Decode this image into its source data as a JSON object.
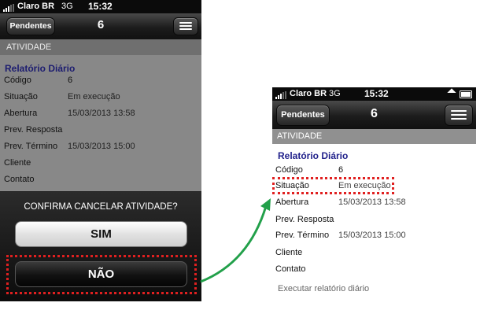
{
  "carrier": "Claro BR",
  "network": "3G",
  "time": "15:32",
  "nav": {
    "back_label": "Pendentes",
    "title": "6"
  },
  "section_header": "ATIVIDADE",
  "report_title": "Relatório Diário",
  "fields": [
    {
      "label": "Código",
      "value": "6"
    },
    {
      "label": "Situação",
      "value": "Em execução"
    },
    {
      "label": "Abertura",
      "value": "15/03/2013 13:58"
    },
    {
      "label": "Prev. Resposta",
      "value": ""
    },
    {
      "label": "Prev. Término",
      "value": "15/03/2013 15:00"
    },
    {
      "label": "Cliente",
      "value": ""
    },
    {
      "label": "Contato",
      "value": ""
    }
  ],
  "action_link": "Executar relatório diário",
  "dialog": {
    "question": "CONFIRMA CANCELAR ATIVIDADE?",
    "yes_label": "SIM",
    "no_label": "NÃO"
  },
  "colors": {
    "highlight": "#e02020",
    "arrow": "#22a04a",
    "report_title": "#1f1f8a"
  }
}
